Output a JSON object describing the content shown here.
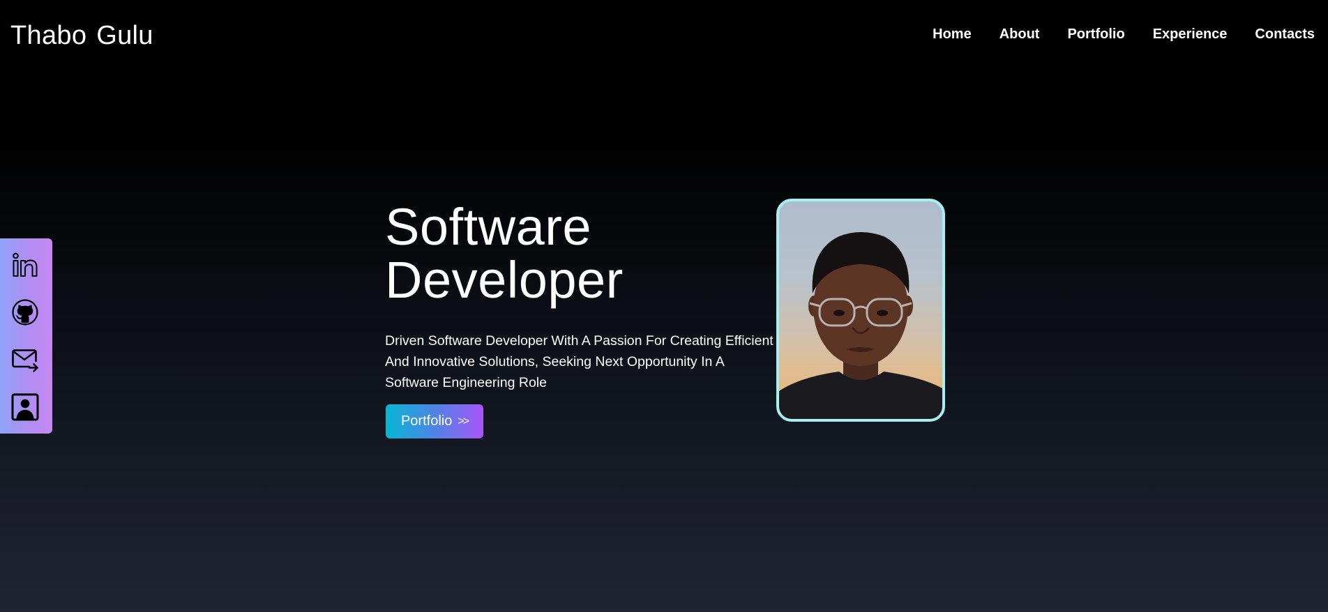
{
  "header": {
    "logo_first": "Thabo",
    "logo_last": "Gulu",
    "nav": [
      {
        "label": "Home"
      },
      {
        "label": "About"
      },
      {
        "label": "Portfolio"
      },
      {
        "label": "Experience"
      },
      {
        "label": "Contacts"
      }
    ]
  },
  "social": {
    "items": [
      {
        "icon": "linkedin-icon"
      },
      {
        "icon": "github-icon"
      },
      {
        "icon": "email-icon"
      },
      {
        "icon": "contact-card-icon"
      }
    ]
  },
  "hero": {
    "title_line1": "Software",
    "title_line2": "Developer",
    "description": "Driven Software Developer With A Passion For Creating Efficient And Innovative Solutions, Seeking Next Opportunity In A Software Engineering Role",
    "button_label": "Portfolio",
    "button_chevron": ">>"
  },
  "colors": {
    "accent_cyan": "#06b6d4",
    "accent_purple": "#a855f7",
    "photo_border": "#a5f0f3",
    "social_bar": "#b48cf3"
  }
}
